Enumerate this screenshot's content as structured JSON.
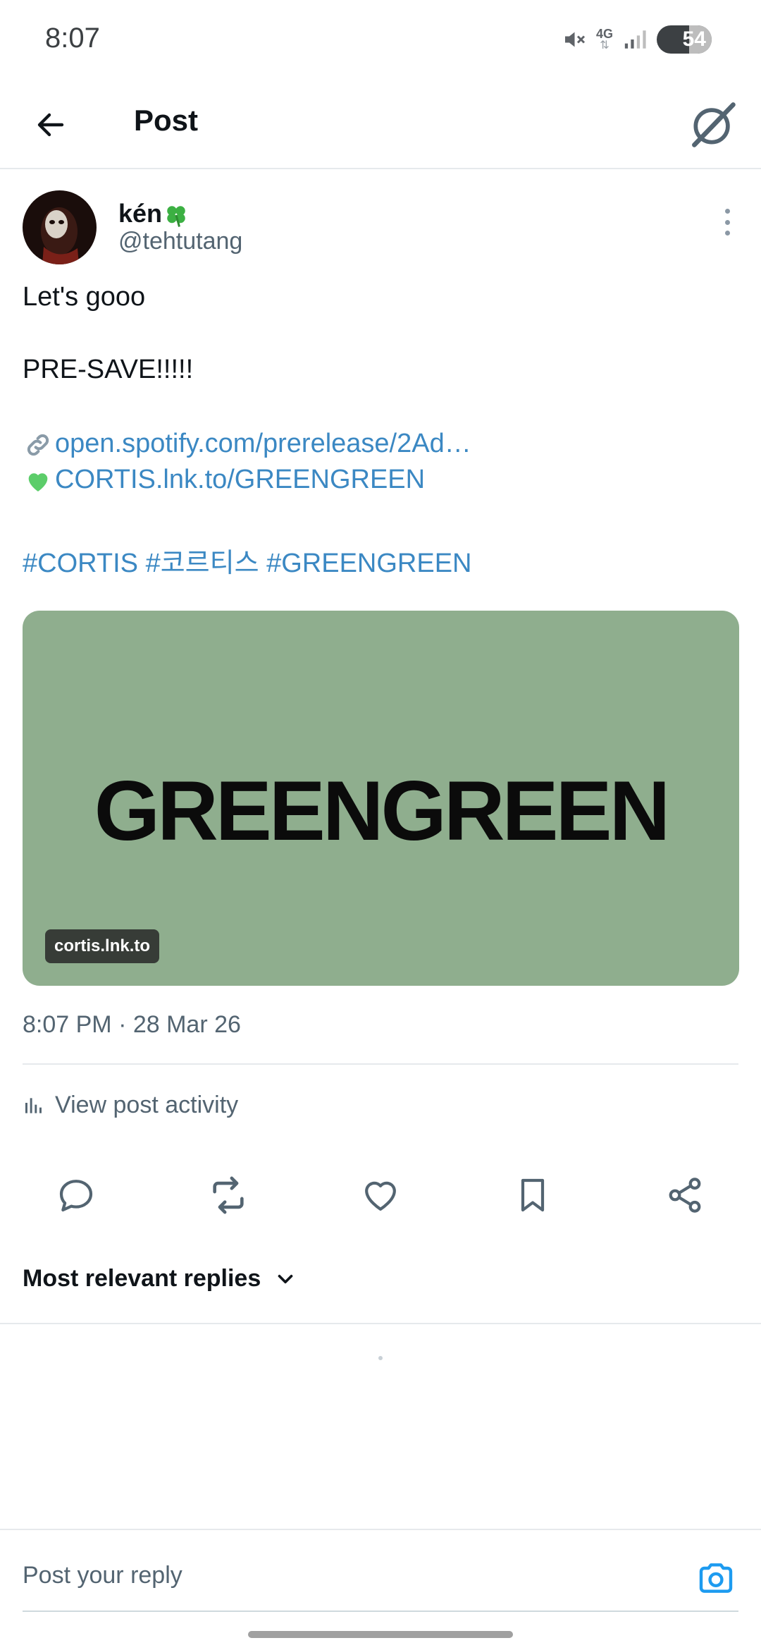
{
  "status_bar": {
    "time": "8:07",
    "network": "4G",
    "battery": "54"
  },
  "header": {
    "title": "Post"
  },
  "author": {
    "name": "kén",
    "handle": "@tehtutang"
  },
  "post": {
    "line1": "Let's gooo",
    "line2": "PRE-SAVE!!!!!",
    "link1": "open.spotify.com/prerelease/2Ad…",
    "link2": "CORTIS.lnk.to/GREENGREEN",
    "hashtags": "#CORTIS #코르티스 #GREENGREEN",
    "timestamp": "8:07 PM · 28 Mar 26"
  },
  "card": {
    "headline": "GREENGREEN",
    "domain": "cortis.lnk.to",
    "background": "#8fae8e"
  },
  "activity": {
    "label": "View post activity"
  },
  "replies": {
    "sort_label": "Most relevant replies"
  },
  "reply_bar": {
    "placeholder": "Post your reply"
  },
  "icons": {
    "status": [
      "mute-icon",
      "network-4g-icon",
      "signal-icon",
      "battery-icon"
    ],
    "header": [
      "back-arrow-icon",
      "grok-icon"
    ],
    "actions": [
      "reply-icon",
      "repost-icon",
      "like-icon",
      "bookmark-icon",
      "share-icon"
    ]
  },
  "colors": {
    "link": "#3b88c3",
    "secondary_text": "#536471",
    "accent": "#1d9bf0"
  }
}
